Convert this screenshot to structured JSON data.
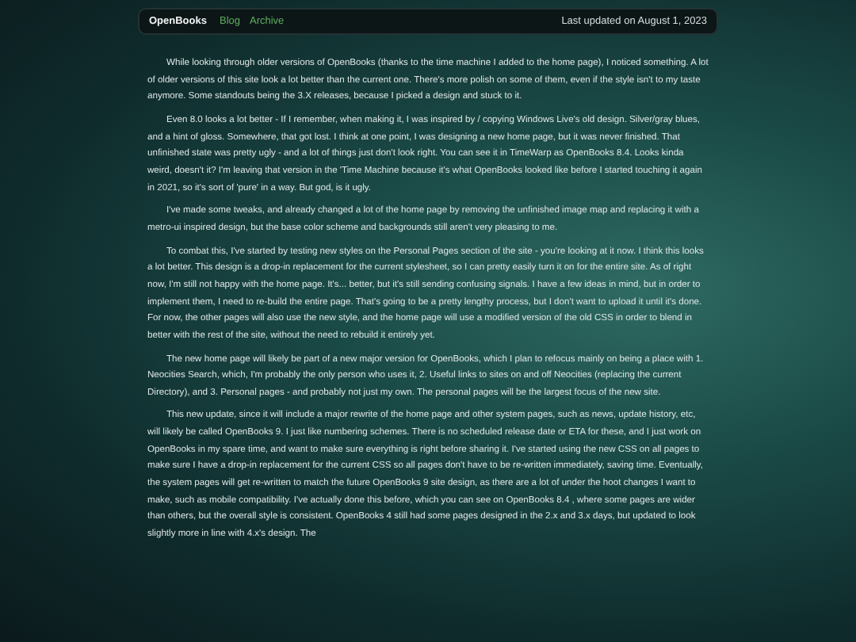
{
  "header": {
    "site_title": "OpenBooks",
    "nav_links": [
      {
        "label": "Blog"
      },
      {
        "label": "Archive"
      }
    ],
    "last_updated": "Last updated on August 1, 2023"
  },
  "article": {
    "paragraphs": [
      "While looking through older versions of OpenBooks (thanks to the time machine I added to the home page), I noticed something. A lot of older versions of this site look a lot better than the current one. There's more polish on some of them, even if the style isn't to my taste anymore. Some standouts being the 3.X releases, because I picked a design and stuck to it.",
      "Even 8.0 looks a lot better - If I remember, when making it, I was inspired by / copying Windows Live's old design. Silver/gray blues, and a hint of gloss. Somewhere, that got lost. I think at one point, I was designing a new home page, but it was never finished. That unfinished state was pretty ugly - and a lot of things just don't look right. You can see it in TimeWarp as OpenBooks 8.4. Looks kinda weird, doesn't it? I'm leaving that version in the 'Time Machine because it's what OpenBooks looked like before I started touching it again in 2021, so it's sort of 'pure' in a way. But god, is it ugly.",
      "I've made some tweaks, and already changed a lot of the home page by removing the unfinished image map and replacing it with a metro-ui inspired design, but the base color scheme and backgrounds still aren't very pleasing to me.",
      "To combat this, I've started by testing new styles on the Personal Pages section of the site - you're looking at it now. I think this looks a lot better. This design is a drop-in replacement for the current stylesheet, so I can pretty easily turn it on for the entire site. As of right now, I'm still not happy with the home page. It's... better, but it's still sending confusing signals. I have a few ideas in mind, but in order to implement them, I need to re-build the entire page. That's going to be a pretty lengthy process, but I don't want to upload it until it's done. For now, the other pages will also use the new style, and the home page will use a modified version of the old CSS in order to blend in better with the rest of the site, without the need to rebuild it entirely yet.",
      "The new home page will likely be part of a new major version for OpenBooks, which I plan to refocus mainly on being a place with 1. Neocities Search, which, I'm probably the only person who uses it, 2. Useful links to sites on and off Neocities (replacing the current Directory), and 3. Personal pages - and probably not just my own. The personal pages will be the largest focus of the new site.",
      "This new update, since it will include a major rewrite of the home page and other system pages, such as news, update history, etc, will likely be called OpenBooks 9. I just like numbering schemes. There is no scheduled release date or ETA for these, and I just work on OpenBooks in my spare time, and want to make sure everything is right before sharing it. I've started using the new CSS on all pages to make sure I have a drop-in replacement for the current CSS so all pages don't have to be re-written immediately, saving time. Eventually, the system pages will get re-written to match the future OpenBooks 9 site design, as there are a lot of under the hoot changes I want to make, such as mobile compatibility. I've actually done this before, which you can see on OpenBooks 8.4 , where some pages are wider than others, but the overall style is consistent. OpenBooks 4 still had some pages designed in the 2.x and 3.x days, but updated to look slightly more in line with 4.x's design. The"
    ]
  }
}
